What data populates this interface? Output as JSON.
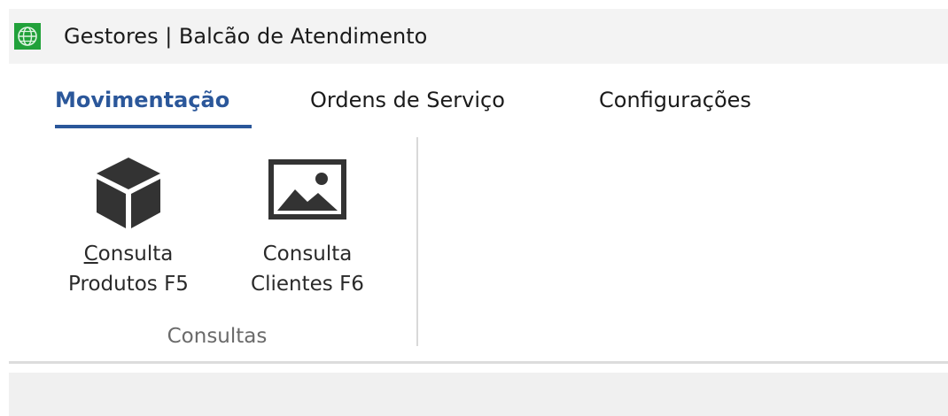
{
  "window": {
    "title": "Gestores |  Balcão de Atendimento",
    "icon": "globe-app-icon"
  },
  "tabs": [
    {
      "label": "Movimentação",
      "active": true
    },
    {
      "label": "Ordens de Serviço",
      "active": false
    },
    {
      "label": "Configurações",
      "active": false
    }
  ],
  "ribbon": {
    "groups": [
      {
        "label": "Consultas",
        "buttons": [
          {
            "line1_accel": "C",
            "line1_rest": "onsulta",
            "line2": "Produtos F5",
            "icon": "cube-icon"
          },
          {
            "line1": "Consulta",
            "line2": "Clientes F6",
            "icon": "image-icon"
          }
        ]
      }
    ]
  },
  "colors": {
    "accent": "#2b579a",
    "titlebar_bg": "#f3f3f3",
    "icon_fill": "#333333",
    "app_icon_green": "#21a13a"
  }
}
